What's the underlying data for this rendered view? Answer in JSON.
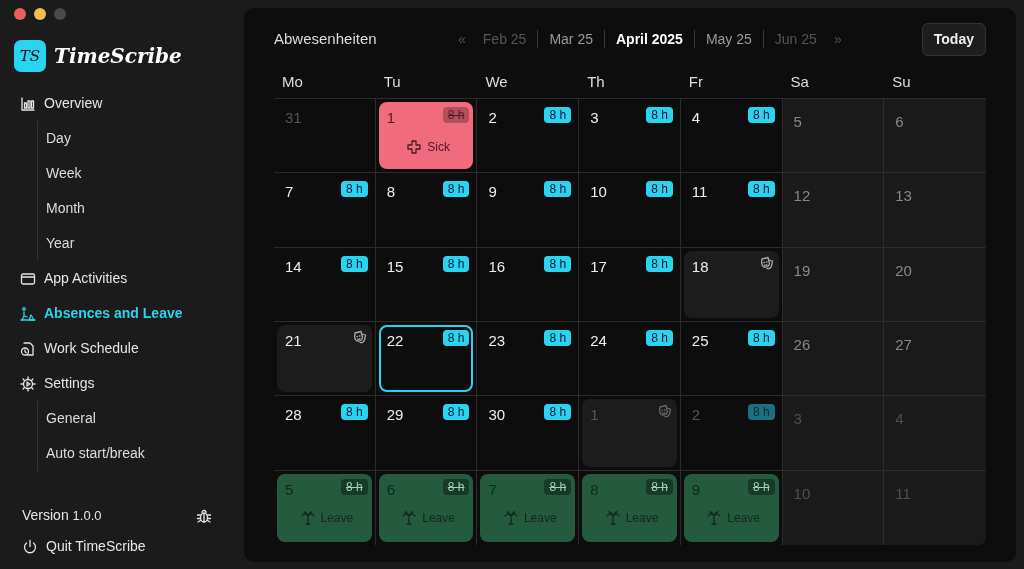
{
  "app": {
    "logo_mark": "TS",
    "name": "TimeScribe"
  },
  "nav": [
    {
      "label": "Overview",
      "selected": false,
      "children": [
        {
          "label": "Day",
          "selected": false
        },
        {
          "label": "Week",
          "selected": false
        },
        {
          "label": "Month",
          "selected": false
        },
        {
          "label": "Year",
          "selected": false
        }
      ]
    },
    {
      "label": "App Activities",
      "selected": false
    },
    {
      "label": "Absences and Leave",
      "selected": true
    },
    {
      "label": "Work Schedule",
      "selected": false
    },
    {
      "label": "Settings",
      "selected": false,
      "children": [
        {
          "label": "General",
          "selected": false
        },
        {
          "label": "Auto start/break",
          "selected": false
        }
      ]
    }
  ],
  "footer": {
    "version_label": "Version",
    "version": "1.0.0",
    "quit": "Quit TimeScribe"
  },
  "header": {
    "title": "Abwesenheiten",
    "prev": "«",
    "next": "»",
    "today_button": "Today",
    "months": [
      {
        "label": "Feb 25",
        "kind": "far",
        "selected": false
      },
      {
        "label": "Mar 25",
        "kind": "near",
        "selected": false
      },
      {
        "label": "April 2025",
        "kind": "near",
        "selected": true
      },
      {
        "label": "May 25",
        "kind": "near",
        "selected": false
      },
      {
        "label": "Jun 25",
        "kind": "far",
        "selected": false
      }
    ]
  },
  "weekdays": [
    "Mo",
    "Tu",
    "We",
    "Th",
    "Fr",
    "Sa",
    "Su"
  ],
  "days": [
    {
      "day": "31",
      "kind": "work",
      "in_month": false,
      "today": false
    },
    {
      "day": "1",
      "kind": "sick",
      "in_month": true,
      "hours": "8 h",
      "hours_struck": true,
      "label": "Sick",
      "today": false
    },
    {
      "day": "2",
      "kind": "work",
      "in_month": true,
      "hours": "8 h",
      "hours_struck": false,
      "today": false
    },
    {
      "day": "3",
      "kind": "work",
      "in_month": true,
      "hours": "8 h",
      "hours_struck": false,
      "today": false
    },
    {
      "day": "4",
      "kind": "work",
      "in_month": true,
      "hours": "8 h",
      "hours_struck": false,
      "today": false
    },
    {
      "day": "5",
      "kind": "weekend",
      "in_month": true,
      "today": false
    },
    {
      "day": "6",
      "kind": "weekend",
      "in_month": true,
      "today": false
    },
    {
      "day": "7",
      "kind": "work",
      "in_month": true,
      "hours": "8 h",
      "hours_struck": false,
      "today": false
    },
    {
      "day": "8",
      "kind": "work",
      "in_month": true,
      "hours": "8 h",
      "hours_struck": false,
      "today": false
    },
    {
      "day": "9",
      "kind": "work",
      "in_month": true,
      "hours": "8 h",
      "hours_struck": false,
      "today": false
    },
    {
      "day": "10",
      "kind": "work",
      "in_month": true,
      "hours": "8 h",
      "hours_struck": false,
      "today": false
    },
    {
      "day": "11",
      "kind": "work",
      "in_month": true,
      "hours": "8 h",
      "hours_struck": false,
      "today": false
    },
    {
      "day": "12",
      "kind": "weekend",
      "in_month": true,
      "today": false
    },
    {
      "day": "13",
      "kind": "weekend",
      "in_month": true,
      "today": false
    },
    {
      "day": "14",
      "kind": "work",
      "in_month": true,
      "hours": "8 h",
      "hours_struck": false,
      "today": false
    },
    {
      "day": "15",
      "kind": "work",
      "in_month": true,
      "hours": "8 h",
      "hours_struck": false,
      "today": false
    },
    {
      "day": "16",
      "kind": "work",
      "in_month": true,
      "hours": "8 h",
      "hours_struck": false,
      "today": false
    },
    {
      "day": "17",
      "kind": "work",
      "in_month": true,
      "hours": "8 h",
      "hours_struck": false,
      "today": false
    },
    {
      "day": "18",
      "kind": "holiday",
      "in_month": true,
      "today": false
    },
    {
      "day": "19",
      "kind": "weekend",
      "in_month": true,
      "today": false
    },
    {
      "day": "20",
      "kind": "weekend",
      "in_month": true,
      "today": false
    },
    {
      "day": "21",
      "kind": "holiday",
      "in_month": true,
      "today": false
    },
    {
      "day": "22",
      "kind": "work",
      "in_month": true,
      "hours": "8 h",
      "hours_struck": false,
      "today": true
    },
    {
      "day": "23",
      "kind": "work",
      "in_month": true,
      "hours": "8 h",
      "hours_struck": false,
      "today": false
    },
    {
      "day": "24",
      "kind": "work",
      "in_month": true,
      "hours": "8 h",
      "hours_struck": false,
      "today": false
    },
    {
      "day": "25",
      "kind": "work",
      "in_month": true,
      "hours": "8 h",
      "hours_struck": false,
      "today": false
    },
    {
      "day": "26",
      "kind": "weekend",
      "in_month": true,
      "today": false
    },
    {
      "day": "27",
      "kind": "weekend",
      "in_month": true,
      "today": false
    },
    {
      "day": "28",
      "kind": "work",
      "in_month": true,
      "hours": "8 h",
      "hours_struck": false,
      "today": false
    },
    {
      "day": "29",
      "kind": "work",
      "in_month": true,
      "hours": "8 h",
      "hours_struck": false,
      "today": false
    },
    {
      "day": "30",
      "kind": "work",
      "in_month": true,
      "hours": "8 h",
      "hours_struck": false,
      "today": false
    },
    {
      "day": "1",
      "kind": "holiday",
      "in_month": false,
      "today": false
    },
    {
      "day": "2",
      "kind": "work",
      "in_month": false,
      "hours": "8 h",
      "hours_struck": false,
      "today": false
    },
    {
      "day": "3",
      "kind": "weekend",
      "in_month": false,
      "today": false
    },
    {
      "day": "4",
      "kind": "weekend",
      "in_month": false,
      "today": false
    },
    {
      "day": "5",
      "kind": "leave",
      "in_month": false,
      "hours": "8 h",
      "hours_struck": true,
      "label": "Leave",
      "today": false
    },
    {
      "day": "6",
      "kind": "leave",
      "in_month": false,
      "hours": "8 h",
      "hours_struck": true,
      "label": "Leave",
      "today": false
    },
    {
      "day": "7",
      "kind": "leave",
      "in_month": false,
      "hours": "8 h",
      "hours_struck": true,
      "label": "Leave",
      "today": false
    },
    {
      "day": "8",
      "kind": "leave",
      "in_month": false,
      "hours": "8 h",
      "hours_struck": true,
      "label": "Leave",
      "today": false
    },
    {
      "day": "9",
      "kind": "leave",
      "in_month": false,
      "hours": "8 h",
      "hours_struck": true,
      "label": "Leave",
      "today": false
    },
    {
      "day": "10",
      "kind": "weekend",
      "in_month": false,
      "today": false
    },
    {
      "day": "11",
      "kind": "weekend",
      "in_month": false,
      "today": false
    }
  ]
}
